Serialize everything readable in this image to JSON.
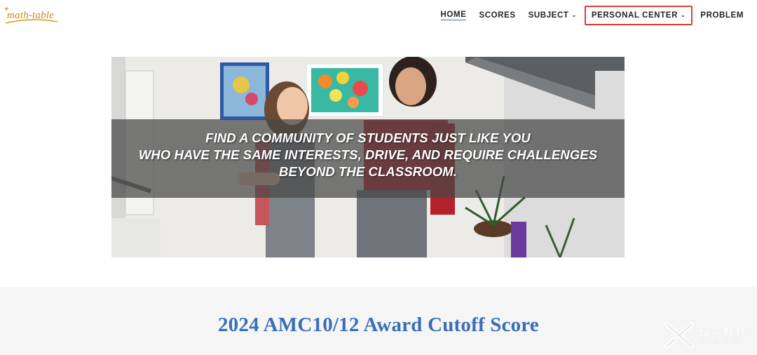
{
  "logo": {
    "text": "math-table",
    "icon": "sparkle-logo-icon"
  },
  "nav": {
    "items": [
      {
        "label": "HOME",
        "active": true,
        "dropdown": false
      },
      {
        "label": "SCORES",
        "active": false,
        "dropdown": false
      },
      {
        "label": "SUBJECT",
        "active": false,
        "dropdown": true
      },
      {
        "label": "PERSONAL CENTER",
        "active": false,
        "dropdown": true,
        "highlighted": true
      },
      {
        "label": "PROBLEM",
        "active": false,
        "dropdown": false
      }
    ],
    "chevron": "⌄"
  },
  "hero": {
    "lines": [
      "FIND A COMMUNITY OF STUDENTS JUST LIKE YOU",
      "WHO HAVE THE SAME INTERESTS, DRIVE, AND REQUIRE CHALLENGES",
      "BEYOND THE CLASSROOM."
    ]
  },
  "section": {
    "title": "2024 AMC10/12 Award Cutoff Score"
  },
  "watermark": {
    "cn": "绿斗教育",
    "en": "X-NEW",
    "icon": "x-logo-icon"
  },
  "colors": {
    "accent": "#3a6fb8",
    "highlight": "#e23b3b",
    "logo": "#c98a12",
    "band": "#464646"
  }
}
